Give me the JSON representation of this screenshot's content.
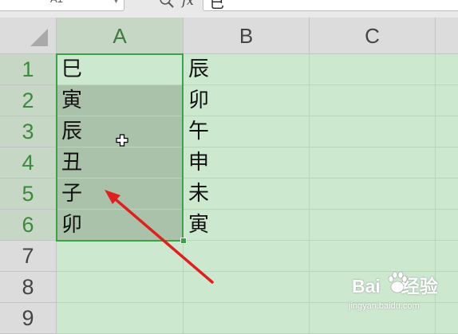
{
  "formula_bar": {
    "name_box": "A1",
    "fx": "fx",
    "formula": "巳"
  },
  "grid": {
    "columns": [
      "A",
      "B",
      "C"
    ],
    "selected_column": "A",
    "rows": [
      {
        "num": "1",
        "a": "巳",
        "b": "辰"
      },
      {
        "num": "2",
        "a": "寅",
        "b": "卯"
      },
      {
        "num": "3",
        "a": "辰",
        "b": "午"
      },
      {
        "num": "4",
        "a": "丑",
        "b": "申"
      },
      {
        "num": "5",
        "a": "子",
        "b": "未"
      },
      {
        "num": "6",
        "a": "卯",
        "b": "寅"
      },
      {
        "num": "7",
        "a": "",
        "b": ""
      },
      {
        "num": "8",
        "a": "",
        "b": ""
      },
      {
        "num": "9",
        "a": "",
        "b": ""
      }
    ]
  },
  "watermark": {
    "brand_left": "Bai",
    "brand_right": "经验",
    "sub": "jingyan.baidu.com"
  },
  "colors": {
    "grid_bg": "#cce8cf",
    "selection_border": "#3aa345",
    "selection_fill": "#a9c2a9",
    "annotation_arrow": "#e02020"
  }
}
